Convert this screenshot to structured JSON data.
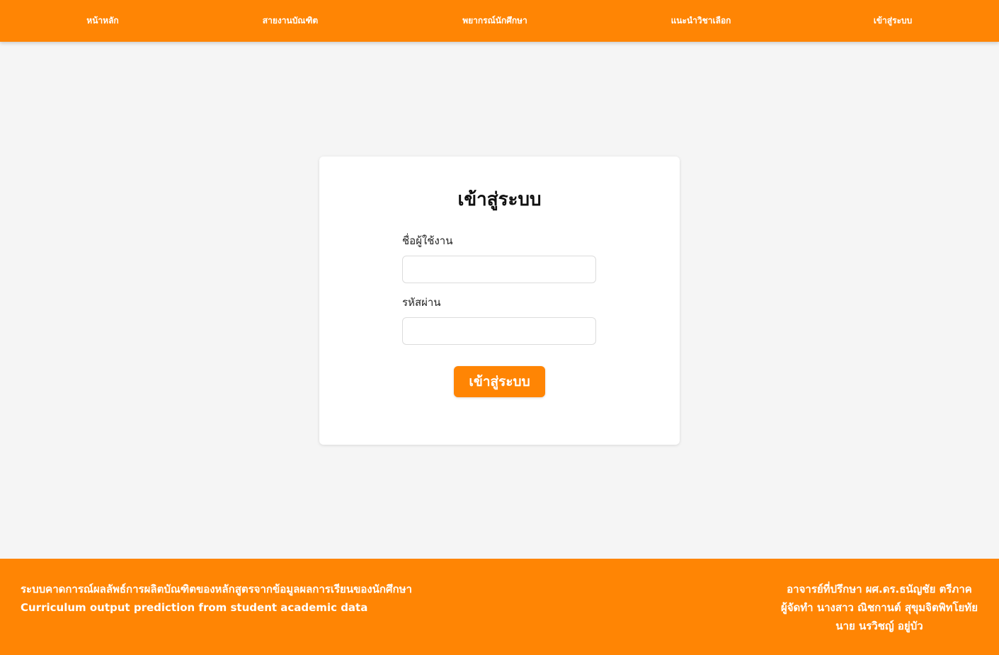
{
  "navbar": {
    "items": [
      {
        "label": "หน้าหลัก"
      },
      {
        "label": "สายงานบัณฑิต"
      },
      {
        "label": "พยากรณ์นักศึกษา"
      },
      {
        "label": "แนะนำวิชาเลือก"
      },
      {
        "label": "เข้าสู่ระบบ"
      }
    ],
    "background": "#ff8504"
  },
  "login": {
    "title": "เข้าสู่ระบบ",
    "username_label": "ชื่อผู้ใช้งาน",
    "username_value": "",
    "password_label": "รหัสผ่าน",
    "password_value": "",
    "submit_label": "เข้าสู่ระบบ"
  },
  "footer": {
    "left_line1": "ระบบคาดการณ์ผลลัพธ์การผลิตบัณฑิตของหลักสูตรจากข้อมูลผลการเรียนของนักศึกษา",
    "left_line2": "Curriculum output prediction from student academic data",
    "right_line1": "อาจารย์ที่ปรึกษา ผศ.ดร.ธนัญชัย ตรีภาค",
    "right_line2": "ผู้จัดทำ นางสาว ณิชกานต์ สุขุมจิตพิทโยทัย",
    "right_line3": "นาย นรวิชญ์ อยู่บัว"
  },
  "colors": {
    "accent": "#ff8504",
    "page_background": "#f5f5f5",
    "card_background": "#ffffff"
  }
}
